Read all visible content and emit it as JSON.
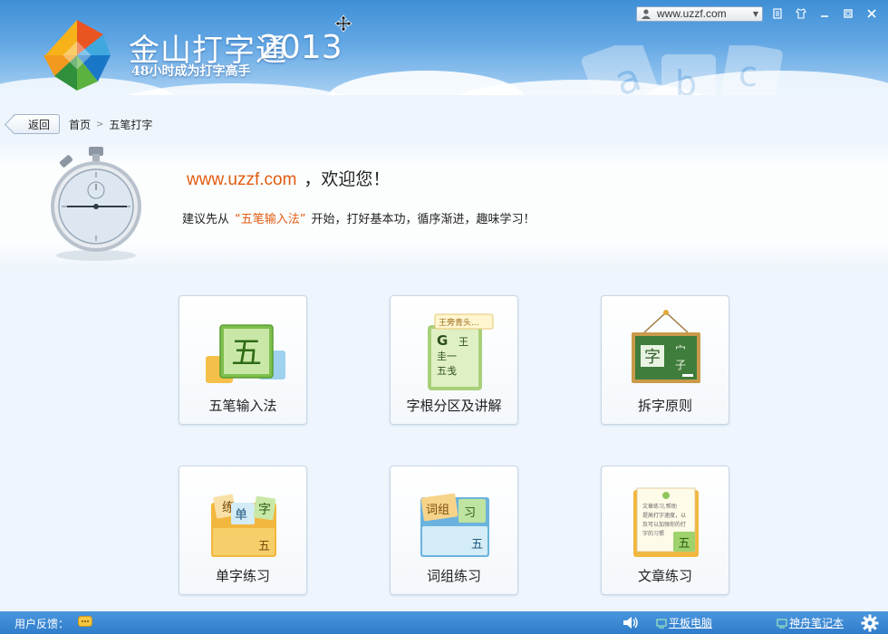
{
  "app": {
    "title": "金山打字通",
    "year": "2013",
    "slogan": "48小时成为打字高手"
  },
  "topbar": {
    "account": "www.uzzf.com",
    "buttons": [
      "skin-icon",
      "shirt-icon",
      "minimize-icon",
      "maximize-icon",
      "close-icon"
    ]
  },
  "breadcrumb": {
    "back": "返回",
    "home": "首页",
    "separator": ">",
    "current": "五笔打字"
  },
  "welcome": {
    "url": "www.uzzf.com",
    "suffix": "，欢迎您！",
    "tip_prefix": "建议先从",
    "tip_highlight": "“五笔输入法”",
    "tip_suffix": "开始，打好基本功，循序渐进，趣味学习！"
  },
  "modules": [
    {
      "label": "五笔输入法"
    },
    {
      "label": "字根分区及讲解"
    },
    {
      "label": "拆字原则"
    },
    {
      "label": "单字练习"
    },
    {
      "label": "词组练习"
    },
    {
      "label": "文章练习"
    }
  ],
  "illustration_text": {
    "wubi_char": "五",
    "zigen_bubble": "王旁青头...",
    "zigen_g": "G",
    "zigen_rows": [
      "王",
      "圭一",
      "五戋"
    ],
    "chaizi_main": "字",
    "chaizi_parts": [
      "宀",
      "子"
    ],
    "danzi_chars": [
      "练",
      "单",
      "字",
      "五"
    ],
    "cizu_chars": [
      "词组",
      "习",
      "五"
    ],
    "wenzhang_text": [
      "文章练习,帮助",
      "提高打字速度，以",
      "及可以加强你的打",
      "字的习惯"
    ],
    "wenzhang_char": "五"
  },
  "statusbar": {
    "feedback": "用户反馈：",
    "promo1": "平板电脑",
    "promo2": "神舟笔记本"
  },
  "colors": {
    "accent_orange": "#e25b10",
    "header_blue": "#3f8fd6",
    "statusbar_blue": "#2f7ccb"
  }
}
